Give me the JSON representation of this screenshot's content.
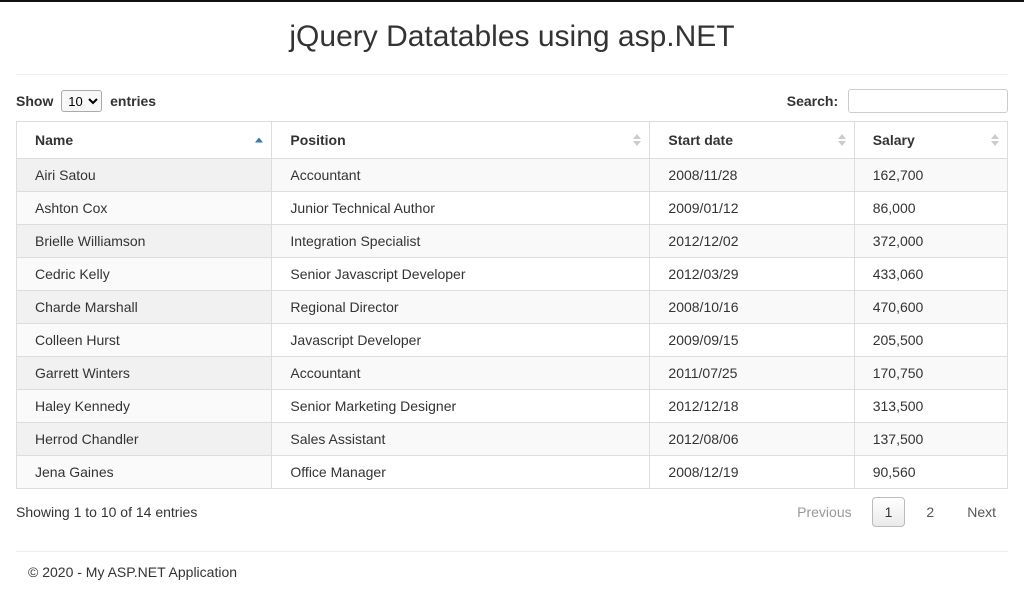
{
  "header": {
    "title": "jQuery Datatables using asp.NET"
  },
  "length": {
    "show_label": "Show",
    "entries_label": "entries",
    "selected": "10"
  },
  "search": {
    "label": "Search:",
    "value": ""
  },
  "columns": [
    {
      "label": "Name",
      "sorted": "asc"
    },
    {
      "label": "Position",
      "sorted": "both"
    },
    {
      "label": "Start date",
      "sorted": "both"
    },
    {
      "label": "Salary",
      "sorted": "both"
    }
  ],
  "rows": [
    {
      "name": "Airi Satou",
      "position": "Accountant",
      "start": "2008/11/28",
      "salary": "162,700"
    },
    {
      "name": "Ashton Cox",
      "position": "Junior Technical Author",
      "start": "2009/01/12",
      "salary": "86,000"
    },
    {
      "name": "Brielle Williamson",
      "position": "Integration Specialist",
      "start": "2012/12/02",
      "salary": "372,000"
    },
    {
      "name": "Cedric Kelly",
      "position": "Senior Javascript Developer",
      "start": "2012/03/29",
      "salary": "433,060"
    },
    {
      "name": "Charde Marshall",
      "position": "Regional Director",
      "start": "2008/10/16",
      "salary": "470,600"
    },
    {
      "name": "Colleen Hurst",
      "position": "Javascript Developer",
      "start": "2009/09/15",
      "salary": "205,500"
    },
    {
      "name": "Garrett Winters",
      "position": "Accountant",
      "start": "2011/07/25",
      "salary": "170,750"
    },
    {
      "name": "Haley Kennedy",
      "position": "Senior Marketing Designer",
      "start": "2012/12/18",
      "salary": "313,500"
    },
    {
      "name": "Herrod Chandler",
      "position": "Sales Assistant",
      "start": "2012/08/06",
      "salary": "137,500"
    },
    {
      "name": "Jena Gaines",
      "position": "Office Manager",
      "start": "2008/12/19",
      "salary": "90,560"
    }
  ],
  "info": {
    "text": "Showing 1 to 10 of 14 entries"
  },
  "pagination": {
    "previous": "Previous",
    "next": "Next",
    "pages": [
      "1",
      "2"
    ],
    "current": "1"
  },
  "footer": {
    "text": "© 2020 - My ASP.NET Application"
  }
}
